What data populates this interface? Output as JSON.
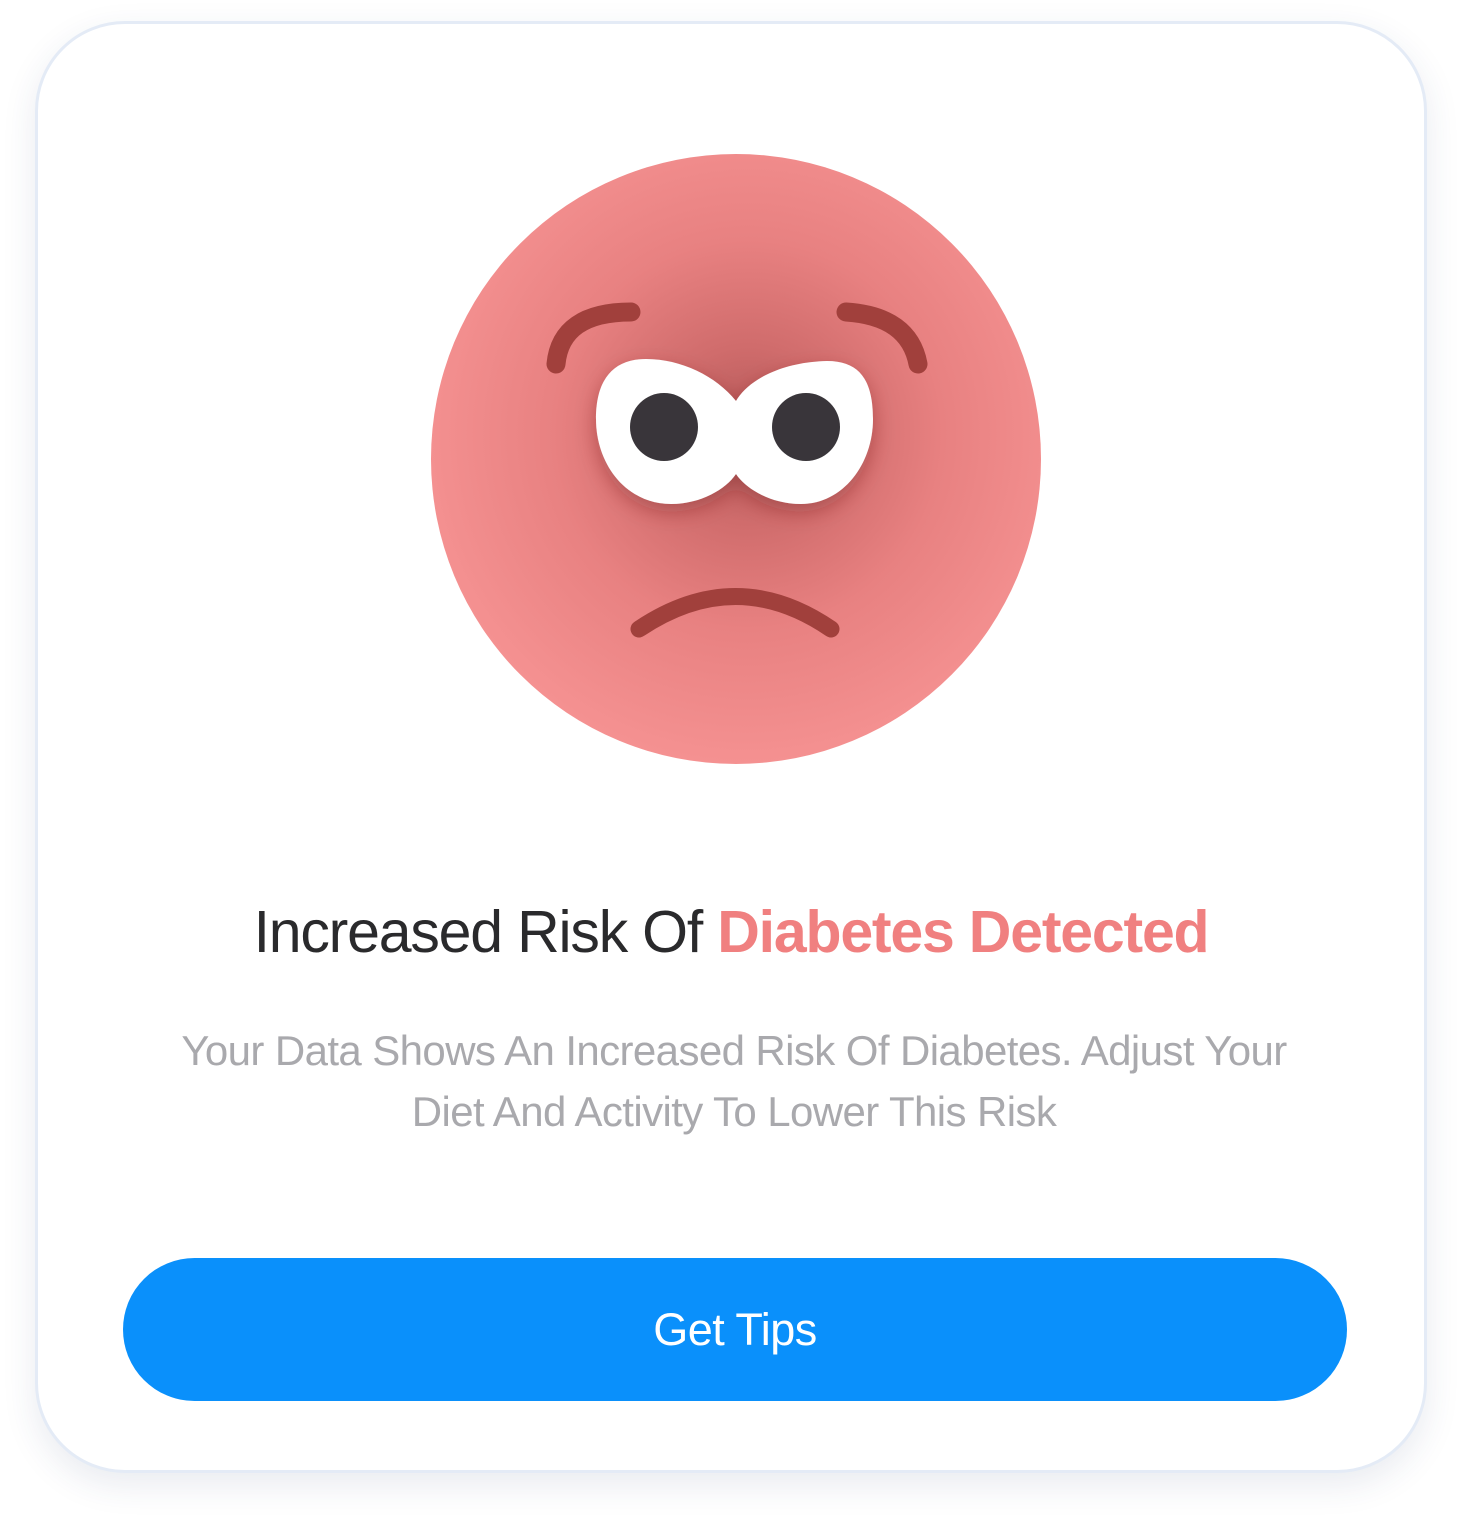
{
  "alert": {
    "icon": "sad-face-icon",
    "title_prefix": "Increased Risk Of ",
    "title_highlight": "Diabetes Detected",
    "description": "Your Data Shows An Increased Risk Of Diabetes. Adjust Your Diet And Activity To Lower This Risk",
    "button_label": "Get Tips"
  },
  "colors": {
    "face": "#f28b8a",
    "face_center": "#b35757",
    "features": "#a1403c",
    "highlight": "#f08080",
    "button": "#0a90fb",
    "title": "#2a2a2c",
    "description": "#a9a9ad",
    "card_border": "#e4ebf6"
  }
}
